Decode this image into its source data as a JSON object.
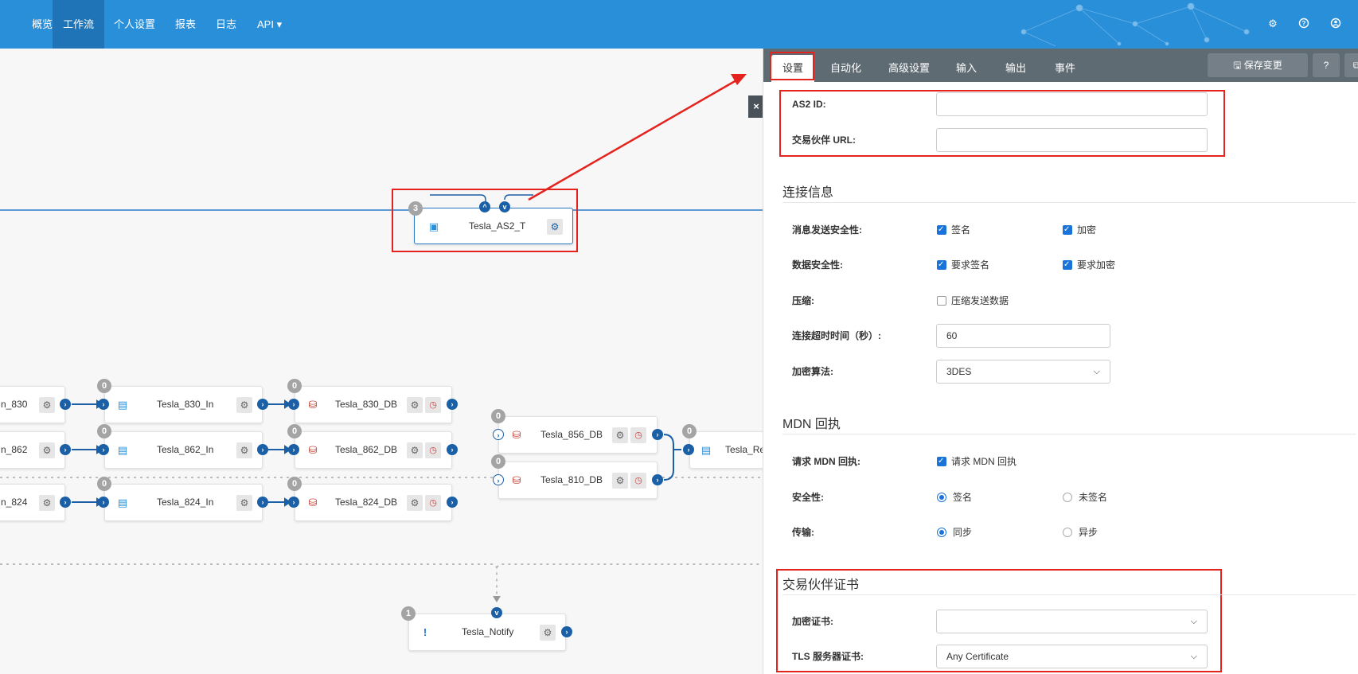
{
  "nav": {
    "items": [
      "概览",
      "工作流",
      "个人设置",
      "报表",
      "日志",
      "API ▾"
    ],
    "active_index": 1,
    "right_icons": [
      "gear-icon",
      "help-icon",
      "user-icon"
    ]
  },
  "canvas": {
    "selected_node": {
      "label": "Tesla_AS2_T",
      "badge": "3"
    },
    "nodes": [
      {
        "label": "n_830",
        "badge": ""
      },
      {
        "label": "n_862",
        "badge": ""
      },
      {
        "label": "n_824",
        "badge": ""
      },
      {
        "label": "Tesla_830_In",
        "badge": "0"
      },
      {
        "label": "Tesla_862_In",
        "badge": "0"
      },
      {
        "label": "Tesla_824_In",
        "badge": "0"
      },
      {
        "label": "Tesla_830_DB",
        "badge": "0"
      },
      {
        "label": "Tesla_862_DB",
        "badge": "0"
      },
      {
        "label": "Tesla_824_DB",
        "badge": "0"
      },
      {
        "label": "Tesla_856_DB",
        "badge": "0"
      },
      {
        "label": "Tesla_810_DB",
        "badge": "0"
      },
      {
        "label": "Tesla_Re",
        "badge": "0"
      },
      {
        "label": "Tesla_Notify",
        "badge": "1"
      }
    ],
    "close_label": "×"
  },
  "panel": {
    "tabs": [
      "设置",
      "自动化",
      "高级设置",
      "输入",
      "输出",
      "事件"
    ],
    "active_tab": 0,
    "save_label": "保存变更",
    "help_label": "?",
    "external_label": "⧉",
    "fields": {
      "as2_id": {
        "label": "AS2 ID:",
        "value": ""
      },
      "partner_url": {
        "label": "交易伙伴 URL:",
        "value": ""
      }
    },
    "connection": {
      "title": "连接信息",
      "send_security_label": "消息发送安全性:",
      "sign_label": "签名",
      "encrypt_label": "加密",
      "data_security_label": "数据安全性:",
      "require_sign_label": "要求签名",
      "require_encrypt_label": "要求加密",
      "compress_label": "压缩:",
      "compress_option": "压缩发送数据",
      "timeout_label": "连接超时时间（秒）:",
      "timeout_value": "60",
      "algo_label": "加密算法:",
      "algo_value": "3DES"
    },
    "mdn": {
      "title": "MDN 回执",
      "request_label": "请求 MDN 回执:",
      "request_option": "请求 MDN 回执",
      "security_label": "安全性:",
      "signed": "签名",
      "unsigned": "未签名",
      "transport_label": "传输:",
      "sync": "同步",
      "async": "异步"
    },
    "cert": {
      "title": "交易伙伴证书",
      "enc_label": "加密证书:",
      "enc_value": "",
      "tls_label": "TLS 服务器证书:",
      "tls_value": "Any Certificate"
    }
  },
  "colors": {
    "nav": "#2a8fd9",
    "nav_active": "#1f74b8",
    "accent": "#1a73d9",
    "highlight": "#e5231e",
    "port": "#1b5fa6"
  }
}
